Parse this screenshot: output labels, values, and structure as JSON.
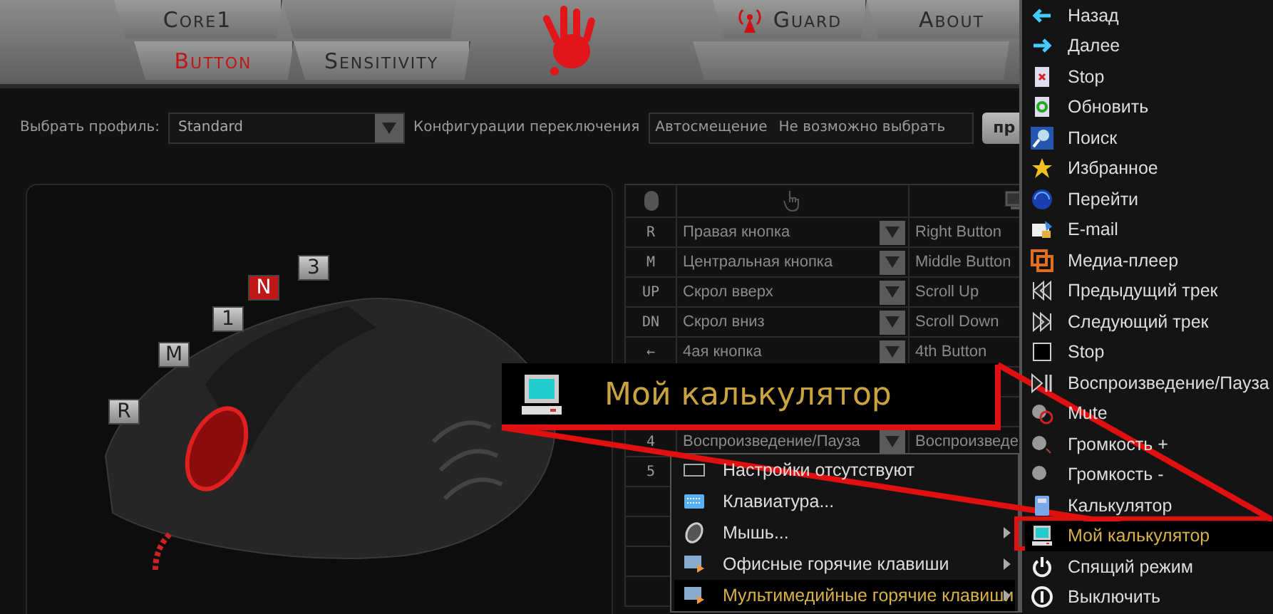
{
  "tabs_top": [
    {
      "label": "Core1",
      "selected": false
    },
    {
      "label": "Guard",
      "selected": false
    },
    {
      "label": "About",
      "selected": false
    }
  ],
  "tabs_bottom": [
    {
      "label": "Button",
      "selected": true
    },
    {
      "label": "Sensitivity",
      "selected": false
    }
  ],
  "profile": {
    "label": "Выбрать профиль:",
    "value": "Standard"
  },
  "switch_config": {
    "label": "Конфигурации переключения",
    "mode": "Автосмещение",
    "note": "Не возможно выбрать"
  },
  "apply_button": "пр",
  "mouse_labels": [
    {
      "label": "R",
      "selected": false
    },
    {
      "label": "M",
      "selected": false
    },
    {
      "label": "1",
      "selected": false
    },
    {
      "label": "N",
      "selected": true
    },
    {
      "label": "3",
      "selected": false
    }
  ],
  "button_table": {
    "rows": [
      {
        "key": "R",
        "action": "Правая кнопка",
        "value": "Right Button"
      },
      {
        "key": "M",
        "action": "Центральная кнопка",
        "value": "Middle Button"
      },
      {
        "key": "UP",
        "action": "Скрол вверх",
        "value": "Scroll Up"
      },
      {
        "key": "DN",
        "action": "Скрол вниз",
        "value": "Scroll Down"
      },
      {
        "key": "←",
        "action": "4ая кнопка",
        "value": "4th Button"
      },
      {
        "key": "4",
        "action": "Воспроизведение/Пауза",
        "value": "Воспроизведе"
      },
      {
        "key": "5"
      }
    ]
  },
  "callout": {
    "label": "Мой калькулятор"
  },
  "submenu": {
    "items": [
      {
        "label": "Настройки отсутствуют",
        "has_submenu": false,
        "selected": false
      },
      {
        "label": "Клавиатура...",
        "has_submenu": false,
        "selected": false
      },
      {
        "label": "Мышь...",
        "has_submenu": true,
        "selected": false
      },
      {
        "label": "Офисные горячие клавиши",
        "has_submenu": true,
        "selected": false
      },
      {
        "label": "Мультимедийные горячие клавиши",
        "has_submenu": true,
        "selected": true
      }
    ]
  },
  "action_menu": {
    "items": [
      {
        "label": "Назад",
        "selected": false
      },
      {
        "label": "Далее",
        "selected": false
      },
      {
        "label": "Stop",
        "selected": false
      },
      {
        "label": "Обновить",
        "selected": false
      },
      {
        "label": "Поиск",
        "selected": false
      },
      {
        "label": "Избранное",
        "selected": false
      },
      {
        "label": "Перейти",
        "selected": false
      },
      {
        "label": "E-mail",
        "selected": false
      },
      {
        "label": "Медиа-плеер",
        "selected": false
      },
      {
        "label": "Предыдущий трек",
        "selected": false
      },
      {
        "label": "Следующий трек",
        "selected": false
      },
      {
        "label": "Stop",
        "selected": false
      },
      {
        "label": "Воспроизведение/Пауза",
        "selected": false
      },
      {
        "label": "Mute",
        "selected": false
      },
      {
        "label": "Громкость +",
        "selected": false
      },
      {
        "label": "Громкость -",
        "selected": false
      },
      {
        "label": "Калькулятор",
        "selected": false
      },
      {
        "label": "Мой калькулятор",
        "selected": true
      },
      {
        "label": "Спящий режим",
        "selected": false
      },
      {
        "label": "Выключить",
        "selected": false
      }
    ]
  }
}
